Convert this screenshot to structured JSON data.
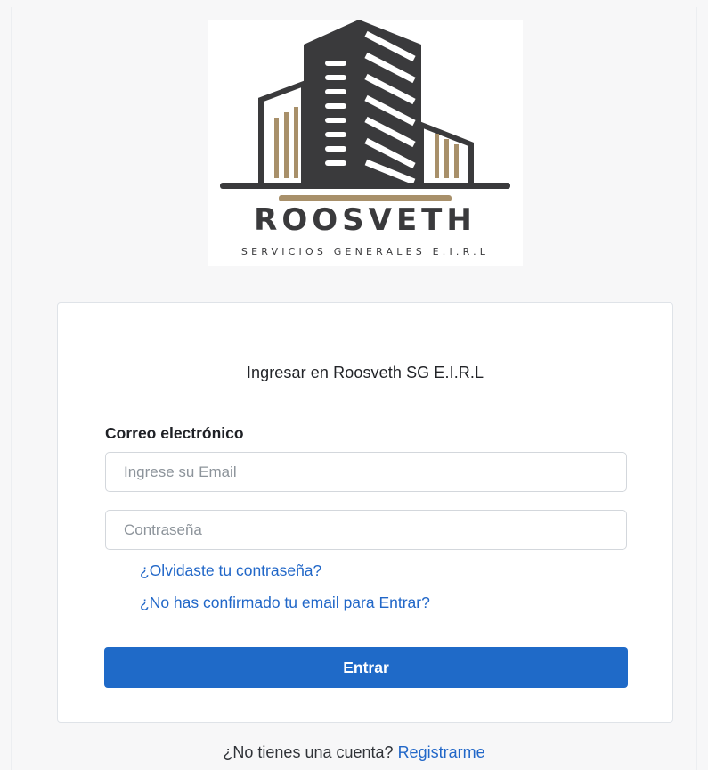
{
  "brand": {
    "name": "ROOSVETH",
    "tagline": "SERVICIOS GENERALES E.I.R.L",
    "colors": {
      "dark": "#3a3a3c",
      "gold": "#a8906a"
    }
  },
  "login": {
    "title": "Ingresar en Roosveth SG E.I.R.L",
    "email_label": "Correo electrónico",
    "email_placeholder": "Ingrese su Email",
    "password_placeholder": "Contraseña",
    "forgot_link": "¿Olvidaste tu contraseña?",
    "confirm_link": "¿No has confirmado tu email para Entrar?",
    "submit_label": "Entrar"
  },
  "footer": {
    "prompt": "¿No tienes una cuenta?",
    "register_link": "Registrarme"
  },
  "colors": {
    "accent": "#1f6ac8",
    "link": "#2167c8"
  }
}
